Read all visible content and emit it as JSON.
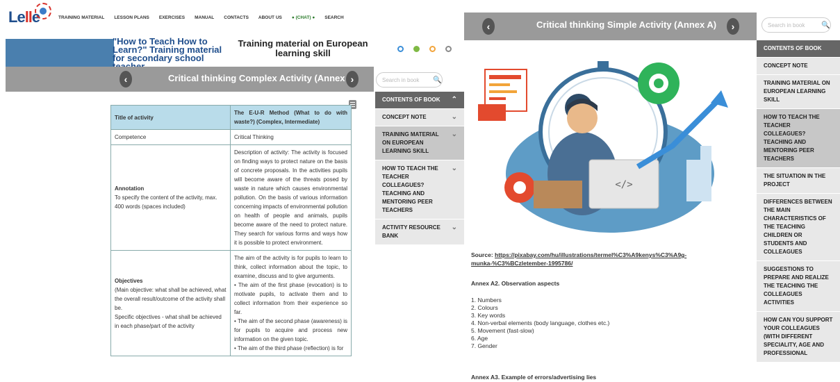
{
  "left_page": {
    "logo": {
      "text_a": "Le",
      "text_b": "ll",
      "text_c": "e"
    },
    "nav": [
      "TRAINING MATERIAL",
      "LESSON PLANS",
      "EXERCISES",
      "MANUAL",
      "CONTACTS",
      "ABOUT US",
      "(CHAT)",
      "SEARCH"
    ],
    "hero_title": "\"How to Teach How to Learn?\" Training material for secondary school teacher",
    "hero_subtitle": "Training material on European learning skill",
    "section_title": "Critical thinking Complex Activity (Annex B)",
    "search_placeholder": "Search in book",
    "close_glyph": "X",
    "table": {
      "rows": [
        {
          "label": "Title of activity",
          "value": "The E-U-R Method (What to do with waste?) (Complex, Intermediate)"
        },
        {
          "label": "Competence",
          "value": "Critical Thinking"
        },
        {
          "label_title": "Annotation",
          "label_sub": "To specify the content of the activity, max. 400 words (spaces included)",
          "value": "Description of activity: The activity is focused on finding ways to protect nature on the basis of concrete proposals. In the activities pupils will become aware of the threats posed by waste in nature which causes environmental pollution. On the basis of various information concerning impacts of environmental pollution on health of people and animals, pupils become aware of the need to protect nature. They search for various forms and ways how it is possible to protect environment."
        },
        {
          "label_title": "Objectives",
          "label_sub1": "(Main objective: what shall be achieved, what the overall result/outcome of the activity shall be.",
          "label_sub2": "Specific objectives - what shall be achieved in each phase/part of the activity",
          "value_intro": "The aim of the activity is for pupils to learn to think, collect information about the topic, to examine, discuss and to give arguments.",
          "bullets": [
            "The aim of the first phase (evocation) is to motivate pupils, to activate them and to collect information from their experience so far.",
            "The aim of the second phase (awareness) is for pupils to acquire and process new information on the given topic.",
            "The aim of the third phase (reflection) is for"
          ]
        }
      ]
    },
    "menu": [
      {
        "label": "CONTENTS OF BOOK",
        "chev": "^",
        "style": "dark"
      },
      {
        "label": "CONCEPT NOTE",
        "chev": "v",
        "style": "light"
      },
      {
        "label": "TRAINING MATERIAL ON EUROPEAN LEARNING SKILL",
        "chev": "v",
        "style": "mid"
      },
      {
        "label": "HOW TO TEACH THE TEACHER COLLEAGUES? TEACHING AND MENTORING PEER TEACHERS",
        "chev": "v",
        "style": "light"
      },
      {
        "label": "ACTIVITY RESOURCE BANK",
        "chev": "v",
        "style": "light"
      }
    ]
  },
  "right_page": {
    "section_title": "Critical thinking Simple Activity (Annex A)",
    "search_placeholder": "Search in book",
    "source_label": "Source:",
    "source_url": "https://pixabay.com/hu/illustrations/termel%C3%A9kenys%C3%A9g-munka-%C3%BCzletember-1995786/",
    "annex_a2": "Annex A2. Observation aspects",
    "aspects": [
      "1. Numbers",
      "2. Colours",
      "3. Key words",
      "4. Non-verbal elements (body language, clothes etc.)",
      "5. Movement (fast-slow)",
      "6. Age",
      "7. Gender"
    ],
    "annex_a3": "Annex A3. Example of errors/advertising lies",
    "menu": [
      {
        "label": "CONTENTS OF BOOK",
        "style": "dark"
      },
      {
        "label": "CONCEPT NOTE",
        "style": "light"
      },
      {
        "label": "TRAINING MATERIAL ON EUROPEAN LEARNING SKILL",
        "style": "light"
      },
      {
        "label": "HOW TO TEACH THE TEACHER COLLEAGUES? TEACHING AND MENTORING PEER TEACHERS",
        "style": "mid"
      },
      {
        "label": "THE SITUATION IN THE PROJECT",
        "style": "light"
      },
      {
        "label": "DIFFERENCES BETWEEN THE MAIN CHARACTERISTICS OF THE TEACHING CHILDREN OR STUDENTS AND COLLEAGUES",
        "style": "light"
      },
      {
        "label": "SUGGESTIONS TO PREPARE AND REALIZE THE TEACHING THE COLLEAGUES ACTIVITIES",
        "style": "light"
      },
      {
        "label": "HOW CAN YOU SUPPORT YOUR COLLEAGUES (WITH DIFFERENT SPECIALITY, AGE AND PROFESSIONAL",
        "style": "light"
      }
    ]
  },
  "colors": {
    "accent_blue": "#4a7fae",
    "bar_gray": "#9a9a9a",
    "menu_dark": "#666666",
    "table_header": "#b9dcea"
  }
}
